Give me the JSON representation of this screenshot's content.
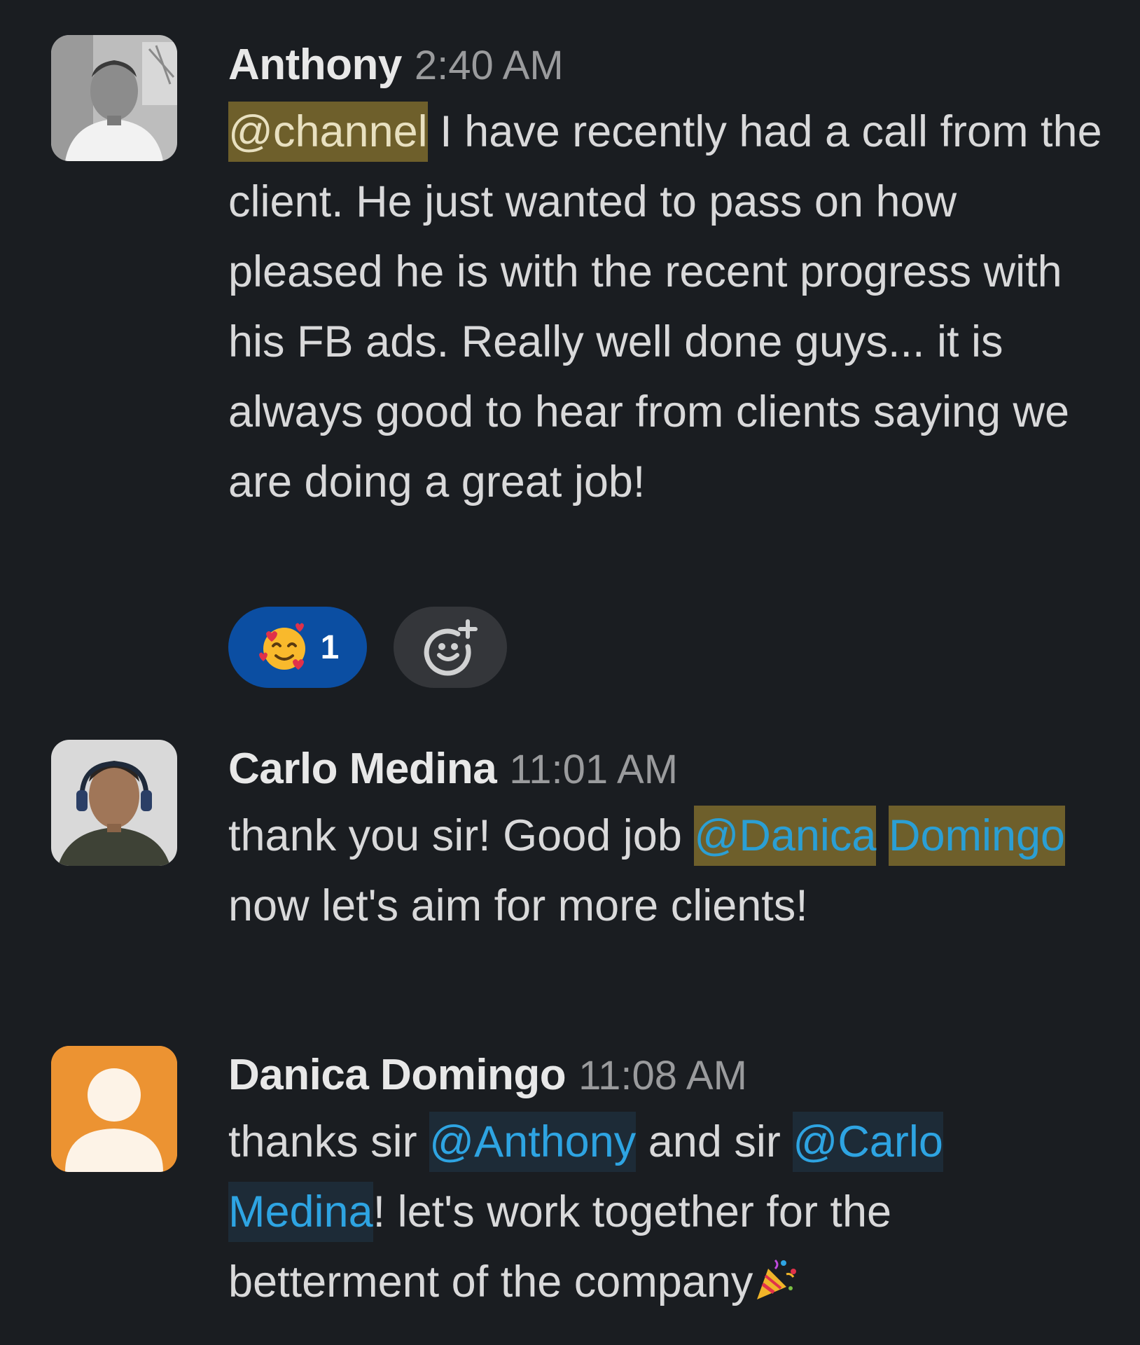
{
  "messages": [
    {
      "author": "Anthony",
      "time": "2:40 AM",
      "mention": "@channel",
      "text": " I have recently had a call from the client. He just wanted to pass on how pleased he is with the recent progress with his FB ads. Really well done guys... it is always good to hear from clients saying we are doing a great job!",
      "reaction": {
        "emoji": "smiling-face-with-hearts-icon",
        "count": "1"
      },
      "add_reaction_icon": "add-reaction-icon"
    },
    {
      "author": "Carlo Medina",
      "time": "11:01 AM",
      "text_before": "thank you sir! Good job ",
      "mention_1": "@Danica",
      "mention_2": "Domingo",
      "text_after": " now let's aim for more clients!"
    },
    {
      "author": "Danica Domingo",
      "time": "11:08 AM",
      "text_1": "thanks sir ",
      "mention_1": "@Anthony",
      "text_2": " and sir ",
      "mention_2a": "@Carlo",
      "mention_2b": "Medina",
      "text_3": "! let's work together for the betterment of the company",
      "trailing_emoji": "party-popper-icon",
      "avatar_color": "#ec9332"
    }
  ],
  "colors": {
    "background": "#1a1d21",
    "mention_highlight": "#6e5f2b",
    "mention_user": "#1d2b37",
    "link_blue": "#2ea4e2",
    "reaction_active": "#0b4ea2"
  }
}
